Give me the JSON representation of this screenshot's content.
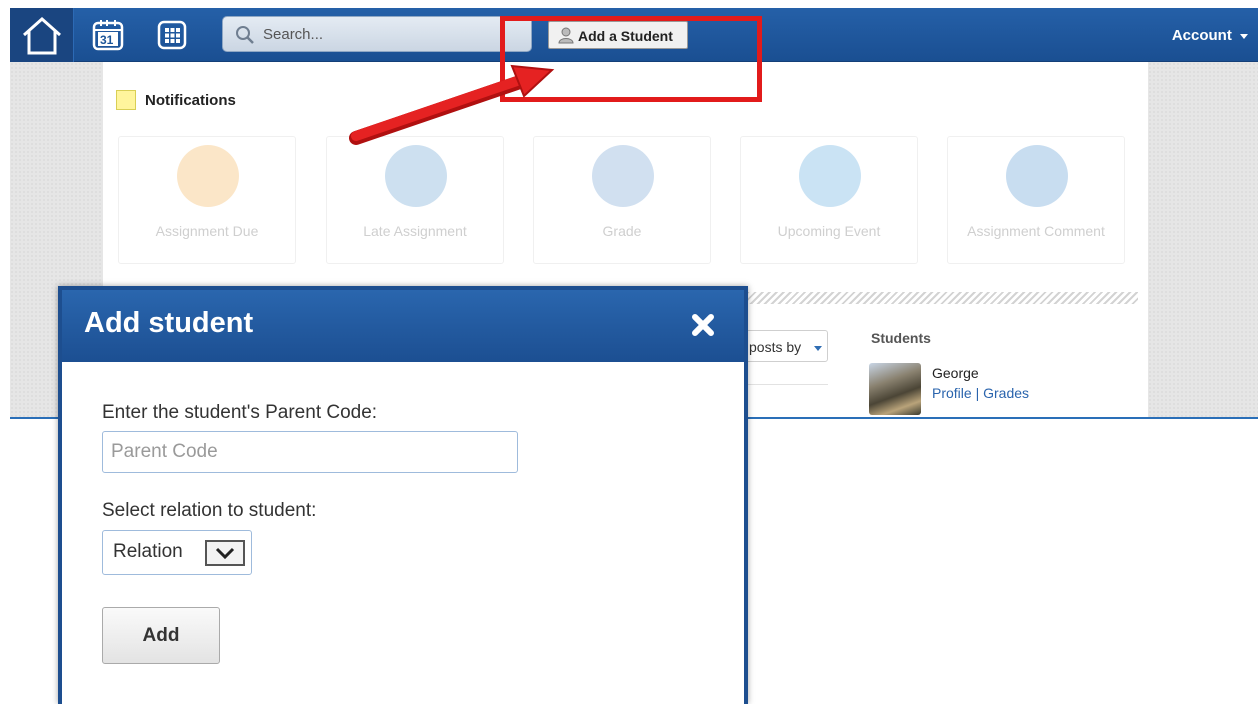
{
  "topbar": {
    "search_placeholder": "Search...",
    "add_student_label": "Add a Student",
    "account_label": "Account",
    "calendar_day": "31",
    "icons": [
      "home-icon",
      "calendar-icon",
      "apps-grid-icon",
      "search-icon",
      "person-icon",
      "chevron-down-icon"
    ]
  },
  "notifications": {
    "title": "Notifications",
    "tiles": [
      {
        "label": "Assignment Due",
        "color": "#f0a53a"
      },
      {
        "label": "Late Assignment",
        "color": "#4a90c8"
      },
      {
        "label": "Grade",
        "color": "#5b8fc9"
      },
      {
        "label": "Upcoming Event",
        "color": "#3f9ad6"
      },
      {
        "label": "Assignment Comment",
        "color": "#3a86c8"
      }
    ]
  },
  "posts": {
    "filter_label": "posts by"
  },
  "students": {
    "title": "Students",
    "items": [
      {
        "name": "George",
        "profile_link": "Profile",
        "separator": " | ",
        "grades_link": "Grades"
      }
    ]
  },
  "modal": {
    "title": "Add student",
    "code_label": "Enter the student's Parent Code:",
    "code_placeholder": "Parent Code",
    "relation_label": "Select relation to student:",
    "relation_selected": "Relation",
    "add_button": "Add"
  },
  "colors": {
    "topbar": "#1c5599",
    "highlight": "#e21b1b",
    "link": "#2a64ad"
  }
}
